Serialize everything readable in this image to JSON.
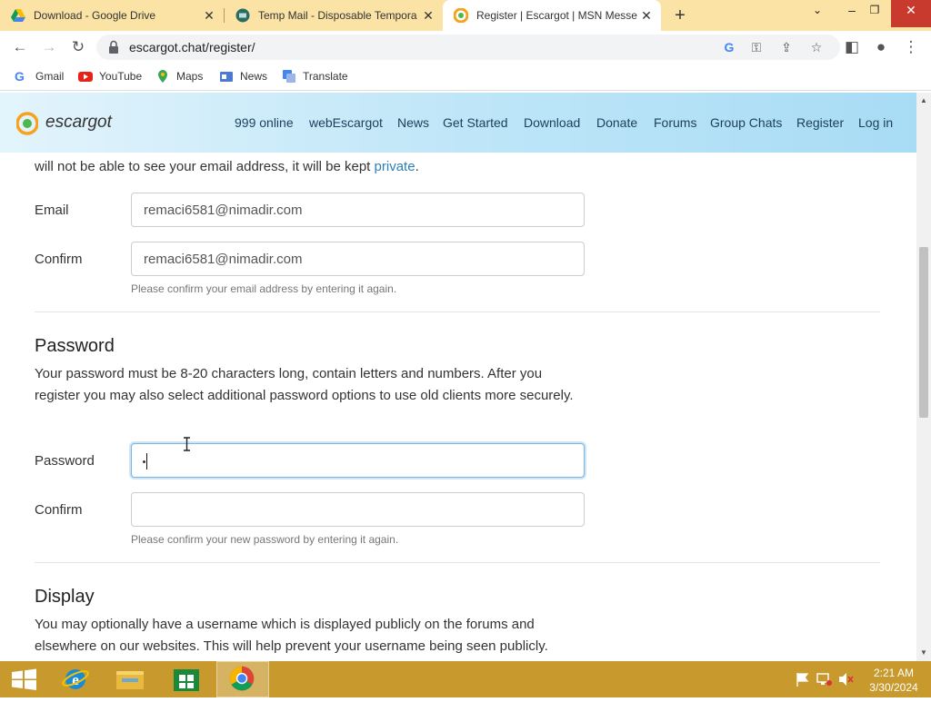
{
  "tabs": [
    {
      "title": "Download - Google Drive",
      "icon": "google-drive-icon"
    },
    {
      "title": "Temp Mail - Disposable Tempora",
      "icon": "temp-mail-icon"
    },
    {
      "title": "Register | Escargot | MSN Messe",
      "icon": "escargot-icon",
      "active": true
    }
  ],
  "url": "escargot.chat/register/",
  "bookmarks": [
    {
      "label": "Gmail",
      "icon": "google-g-icon"
    },
    {
      "label": "YouTube",
      "icon": "youtube-icon"
    },
    {
      "label": "Maps",
      "icon": "maps-pin-icon"
    },
    {
      "label": "News",
      "icon": "news-icon"
    },
    {
      "label": "Translate",
      "icon": "translate-icon"
    }
  ],
  "site": {
    "logo": "escargot",
    "nav": [
      "999 online",
      "webEscargot",
      "News",
      "Get Started",
      "Download",
      "Donate",
      "Forums",
      "Group Chats",
      "Register",
      "Log in"
    ]
  },
  "form": {
    "intro_prefix": "will not be able to see your email address, it will be kept ",
    "intro_link": "private",
    "intro_suffix": ".",
    "email_label": "Email",
    "email_value": "remaci6581@nimadir.com",
    "confirm_label": "Confirm",
    "confirm_email_value": "remaci6581@nimadir.com",
    "confirm_email_hint": "Please confirm your email address by entering it again.",
    "password_heading": "Password",
    "password_desc": "Your password must be 8-20 characters long, contain letters and numbers. After you register you may also select additional password options to use old clients more securely.",
    "password_label": "Password",
    "password_confirm_label": "Confirm",
    "password_confirm_hint": "Please confirm your new password by entering it again.",
    "display_heading": "Display",
    "display_desc": "You may optionally have a username which is displayed publicly on the forums and elsewhere on our websites. This will help prevent your username being seen publicly."
  },
  "clock": {
    "time": "2:21 AM",
    "date": "3/30/2024"
  },
  "colors": {
    "taskbar": "#c89a2e",
    "tabstrip": "#fbe3a5",
    "link": "#2a7fb8",
    "header_grad_end": "#a8dcf5"
  }
}
